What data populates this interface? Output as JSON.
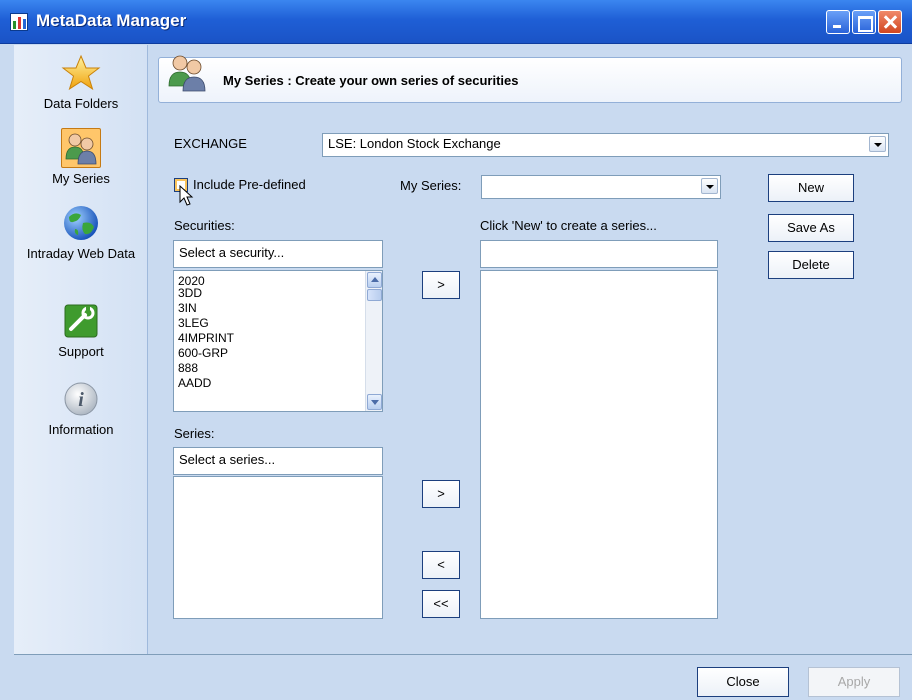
{
  "window": {
    "title": "MetaData Manager"
  },
  "sidebar": {
    "items": [
      {
        "label": "Data Folders",
        "icon": "star-icon",
        "selected": false
      },
      {
        "label": "My Series",
        "icon": "users-icon",
        "selected": true
      },
      {
        "label": "Intraday Web Data",
        "icon": "globe-icon",
        "selected": false
      },
      {
        "label": "Support",
        "icon": "wrench-icon",
        "selected": false
      },
      {
        "label": "Information",
        "icon": "info-icon",
        "selected": false
      }
    ]
  },
  "header": {
    "title": "My Series : Create your own series of securities"
  },
  "exchange": {
    "label": "EXCHANGE",
    "value": "LSE: London Stock Exchange"
  },
  "include_predefined": {
    "label": "Include Pre-defined",
    "checked": false
  },
  "my_series": {
    "label": "My Series:",
    "value": ""
  },
  "securities": {
    "label": "Securities:",
    "filter_value": "Select a security...",
    "items": [
      "2020",
      "3DD",
      "3IN",
      "3LEG",
      "4IMPRINT",
      "600-GRP",
      "888",
      "AADD"
    ]
  },
  "series": {
    "label": "Series:",
    "filter_value": "Select a series...",
    "items": []
  },
  "new_series_panel": {
    "hint": "Click 'New' to create a series...",
    "name_value": "",
    "items": []
  },
  "transfer_buttons": {
    "add_security": ">",
    "add_series": ">",
    "remove": "<",
    "remove_all": "<<"
  },
  "actions": {
    "new": "New",
    "save_as": "Save As",
    "delete": "Delete"
  },
  "footer": {
    "close": "Close",
    "apply": "Apply"
  },
  "colors": {
    "titlebar": "#2563d8",
    "panel_background": "#c9daf0",
    "selected_nav": "#ffc66a"
  }
}
